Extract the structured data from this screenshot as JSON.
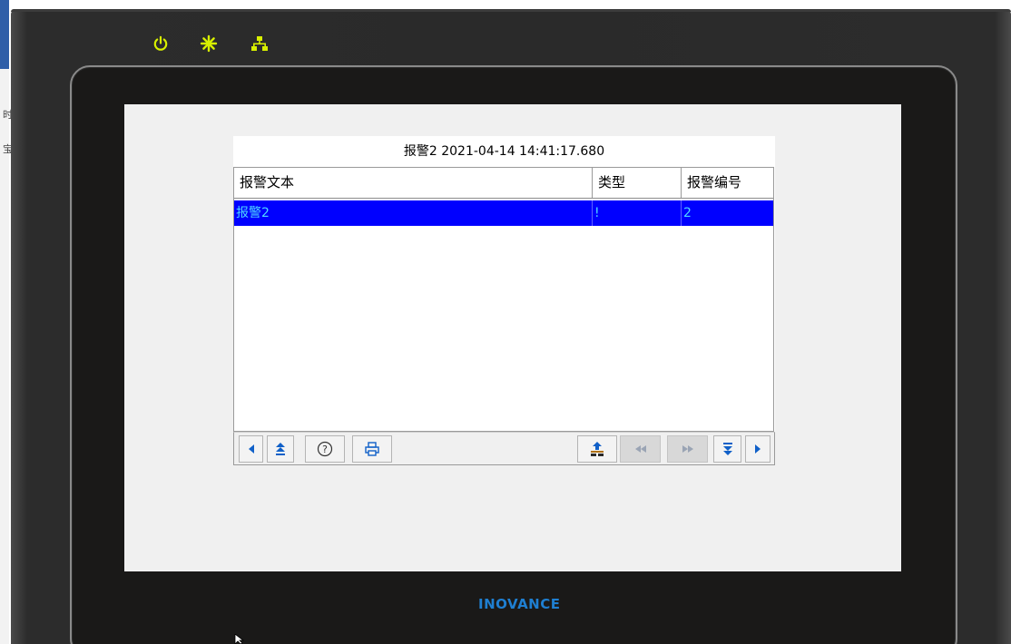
{
  "window": {
    "bg_chars": [
      "时",
      "宝"
    ]
  },
  "device": {
    "status_icons": [
      "power-icon",
      "run-icon",
      "network-icon"
    ],
    "led_color": "#d8f000",
    "brand": "INOVANCE",
    "brand_color": "#1f7fd1"
  },
  "alarm_view": {
    "title": "报警2 2021-04-14 14:41:17.680",
    "columns": [
      "报警文本",
      "类型",
      "报警编号"
    ],
    "rows": [
      {
        "text": "报警2",
        "type": "!",
        "number": "2",
        "selected": true
      }
    ],
    "selected_bg": "#0000ff",
    "selected_fg": "#4fd8ff",
    "toolbar": [
      {
        "icon": "arrow-left-icon"
      },
      {
        "icon": "arrow-up-top-icon"
      },
      {
        "icon": "help-icon"
      },
      {
        "icon": "print-icon"
      },
      {
        "icon": "acknowledge-icon"
      },
      {
        "icon": "page-back-icon",
        "disabled": true
      },
      {
        "icon": "page-forward-icon",
        "disabled": true
      },
      {
        "icon": "arrow-down-bottom-icon"
      },
      {
        "icon": "arrow-right-icon"
      }
    ]
  }
}
